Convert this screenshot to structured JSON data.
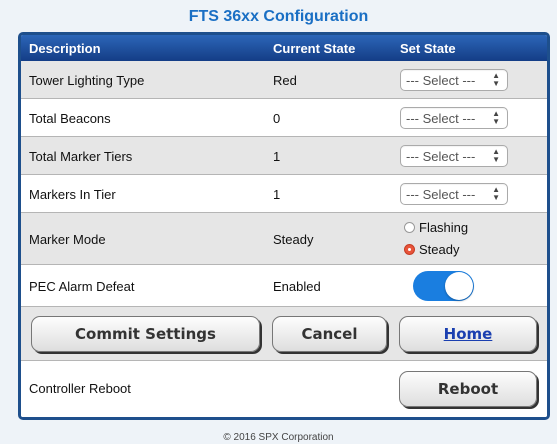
{
  "title": "FTS 36xx Configuration",
  "columns": {
    "description": "Description",
    "current_state": "Current State",
    "set_state": "Set State"
  },
  "rows": [
    {
      "description": "Tower Lighting Type",
      "current": "Red",
      "select_value": "--- Select ---"
    },
    {
      "description": "Total Beacons",
      "current": "0",
      "select_value": "--- Select ---"
    },
    {
      "description": "Total Marker Tiers",
      "current": "1",
      "select_value": "--- Select ---"
    },
    {
      "description": "Markers In Tier",
      "current": "1",
      "select_value": "--- Select ---"
    }
  ],
  "marker_mode": {
    "description": "Marker Mode",
    "current": "Steady",
    "options": [
      "Flashing",
      "Steady"
    ],
    "selected": "Steady"
  },
  "pec_alarm": {
    "description": "PEC Alarm Defeat",
    "current": "Enabled",
    "toggle_on": true
  },
  "buttons": {
    "commit": "Commit Settings",
    "cancel": "Cancel",
    "home": "Home",
    "reboot": "Reboot"
  },
  "reboot_row": {
    "description": "Controller Reboot"
  },
  "footer": "© 2016 SPX Corporation",
  "colors": {
    "header_bg": "#1e4f8c",
    "title": "#1a6fc4",
    "toggle_on": "#1a7ee0",
    "radio_selected": "#e8543a"
  }
}
